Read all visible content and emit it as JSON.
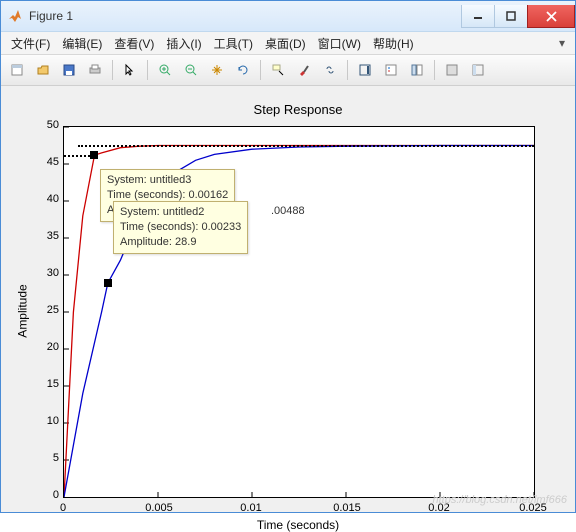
{
  "window": {
    "title": "Figure 1"
  },
  "menu": {
    "file": "文件(F)",
    "edit": "编辑(E)",
    "view": "查看(V)",
    "insert": "插入(I)",
    "tools": "工具(T)",
    "desktop": "桌面(D)",
    "window": "窗口(W)",
    "help": "帮助(H)",
    "tail": "▾"
  },
  "chart": {
    "title": "Step Response",
    "xlabel": "Time (seconds)",
    "ylabel": "Amplitude"
  },
  "yticks": {
    "t0": "0",
    "t5": "5",
    "t10": "10",
    "t15": "15",
    "t20": "20",
    "t25": "25",
    "t30": "30",
    "t35": "35",
    "t40": "40",
    "t45": "45",
    "t50": "50"
  },
  "xticks": {
    "x0": "0",
    "x005": "0.005",
    "x01": "0.01",
    "x015": "0.015",
    "x02": "0.02",
    "x025": "0.025"
  },
  "tip1": {
    "l1": "System: untitled3",
    "l2": "Time (seconds): 0.00162",
    "l3a": "A",
    "trail": ".00488"
  },
  "tip2": {
    "l1": "System: untitled2",
    "l2": "Time (seconds): 0.00233",
    "l3": "Amplitude: 28.9"
  },
  "watermark": "https://blog.csdn.net/lmf666",
  "chart_data": {
    "type": "line",
    "title": "Step Response",
    "xlabel": "Time (seconds)",
    "ylabel": "Amplitude",
    "xlim": [
      0,
      0.025
    ],
    "ylim": [
      0,
      50
    ],
    "final_value": 47.5,
    "series": [
      {
        "name": "untitled3",
        "color": "#cc0000",
        "x": [
          0,
          0.0005,
          0.001,
          0.00162,
          0.002,
          0.003,
          0.004,
          0.005,
          0.007,
          0.01,
          0.015,
          0.02,
          0.025
        ],
        "y": [
          0,
          25,
          38,
          46.2,
          46.5,
          47.2,
          47.4,
          47.5,
          47.5,
          47.5,
          47.5,
          47.5,
          47.5
        ]
      },
      {
        "name": "untitled2",
        "color": "#0000cc",
        "x": [
          0,
          0.001,
          0.002,
          0.00233,
          0.003,
          0.004,
          0.005,
          0.006,
          0.007,
          0.008,
          0.01,
          0.0125,
          0.015,
          0.02,
          0.025
        ],
        "y": [
          0,
          14,
          25,
          28.9,
          32,
          38,
          41.5,
          44,
          45.5,
          46.3,
          47,
          47.3,
          47.4,
          47.5,
          47.5
        ]
      }
    ],
    "datatips": [
      {
        "system": "untitled3",
        "time": 0.00162,
        "amplitude": 46.2
      },
      {
        "system": "untitled2",
        "time": 0.00233,
        "amplitude": 28.9
      },
      {
        "partial_visible_value": 0.00488
      }
    ]
  }
}
